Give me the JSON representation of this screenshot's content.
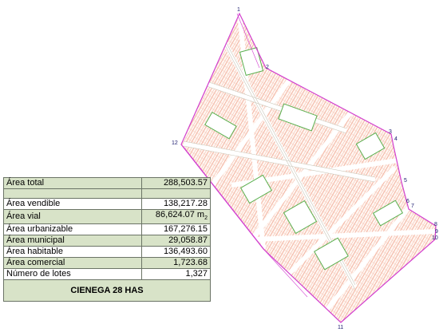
{
  "plan": {
    "vertices": [
      "1",
      "2",
      "3",
      "4",
      "5",
      "6",
      "7",
      "8",
      "9",
      "10",
      "11",
      "12"
    ],
    "colors": {
      "boundary": "#d23fcf",
      "road": "#e8e6d8",
      "lot": "#f3b7a4",
      "green": "#5ab04f",
      "label": "#1a1a6e"
    }
  },
  "table": {
    "rows": [
      {
        "label": "Área total",
        "value": "288,503.57"
      },
      {
        "label": "Área vendible",
        "value": "138,217.28"
      },
      {
        "label": "Área vial",
        "value": "86,624.07",
        "unit": "m",
        "unit_sub": "2"
      },
      {
        "label": "Área urbanizable",
        "value": "167,276.15"
      },
      {
        "label": "Área municipal",
        "value": "29,058.87"
      },
      {
        "label": "Área habitable",
        "value": "136,493.60"
      },
      {
        "label": "Área comercial",
        "value": "1,723.68"
      },
      {
        "label": "Número de lotes",
        "value": "1,327"
      }
    ],
    "caption": "CIENEGA 28 HAS"
  }
}
